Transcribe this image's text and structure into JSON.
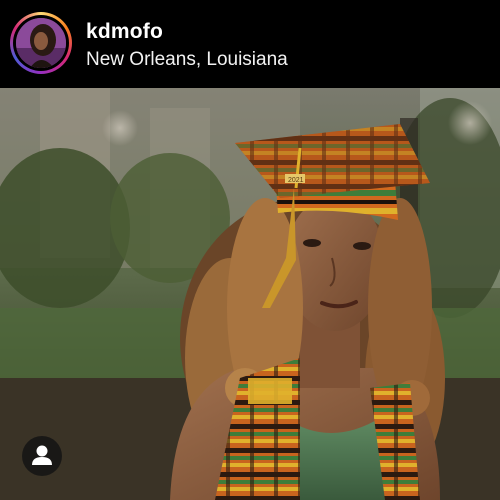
{
  "post": {
    "username": "kdmofo",
    "location": "New Orleans, Louisiana"
  },
  "photo": {
    "cap_year": "2021"
  },
  "icons": {
    "tags": "person-icon"
  },
  "colors": {
    "header_background": "#000000",
    "text_primary": "#ffffff",
    "story_ring": [
      "#feda75",
      "#fa7e1e",
      "#d62976",
      "#962fbf",
      "#4f5bd5"
    ],
    "kente_orange": "#c8641e",
    "kente_green": "#3f7d3a",
    "kente_yellow": "#e0b12c",
    "dress_green": "#4f7a55"
  }
}
